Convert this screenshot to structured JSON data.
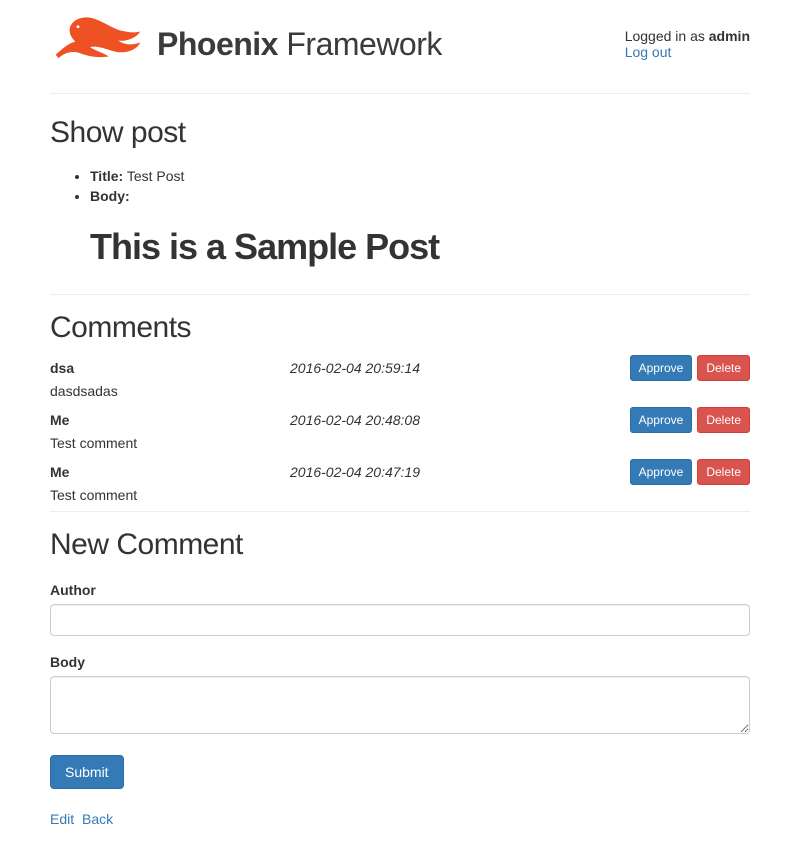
{
  "header": {
    "logo_bold": "Phoenix",
    "logo_light": " Framework",
    "auth_prefix": "Logged in as ",
    "auth_user": "admin",
    "logout": "Log out"
  },
  "post": {
    "heading": "Show post",
    "title_label": "Title:",
    "title_value": "Test Post",
    "body_label": "Body:",
    "body_content": "This is a Sample Post"
  },
  "comments": {
    "heading": "Comments",
    "approve_label": "Approve",
    "delete_label": "Delete",
    "items": [
      {
        "author": "dsa",
        "date": "2016-02-04 20:59:14",
        "body": "dasdsadas"
      },
      {
        "author": "Me",
        "date": "2016-02-04 20:48:08",
        "body": "Test comment"
      },
      {
        "author": "Me",
        "date": "2016-02-04 20:47:19",
        "body": "Test comment"
      }
    ]
  },
  "form": {
    "heading": "New Comment",
    "author_label": "Author",
    "body_label": "Body",
    "submit_label": "Submit"
  },
  "nav": {
    "edit": "Edit",
    "back": "Back"
  }
}
